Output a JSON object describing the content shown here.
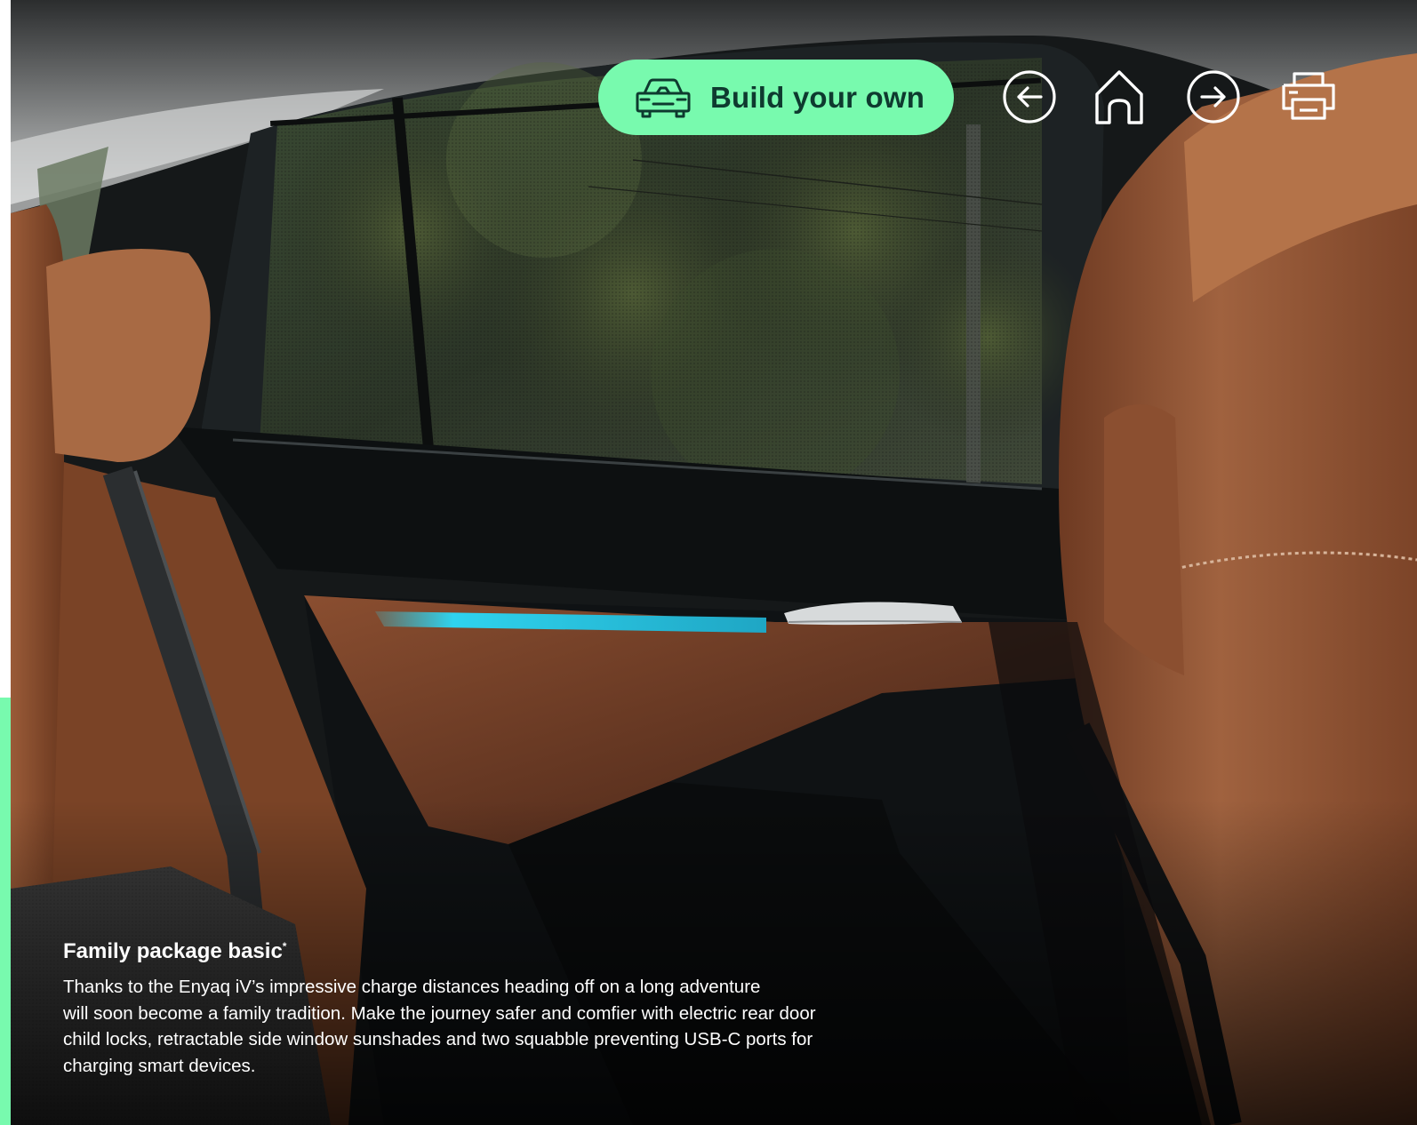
{
  "toolbar": {
    "build_label": "Build your own",
    "icons": [
      "car-icon",
      "back-arrow-icon",
      "home-icon",
      "forward-arrow-icon",
      "print-icon"
    ]
  },
  "feature": {
    "title": "Family package basic",
    "title_marker": "*",
    "body": "Thanks to the Enyaq iV’s impressive charge distances heading off on a long adventure\nwill soon become a family tradition. Make the journey safer and comfier with electric rear door\nchild locks, retractable side window sunshades and two squabble preventing USB-C ports for\ncharging smart devices."
  },
  "colors": {
    "accent": "#78faae",
    "button_text": "#0e3a2f",
    "caption_text": "#ffffff",
    "ambient_light": "#2fd3ee",
    "leather": "#8a4a2a"
  }
}
